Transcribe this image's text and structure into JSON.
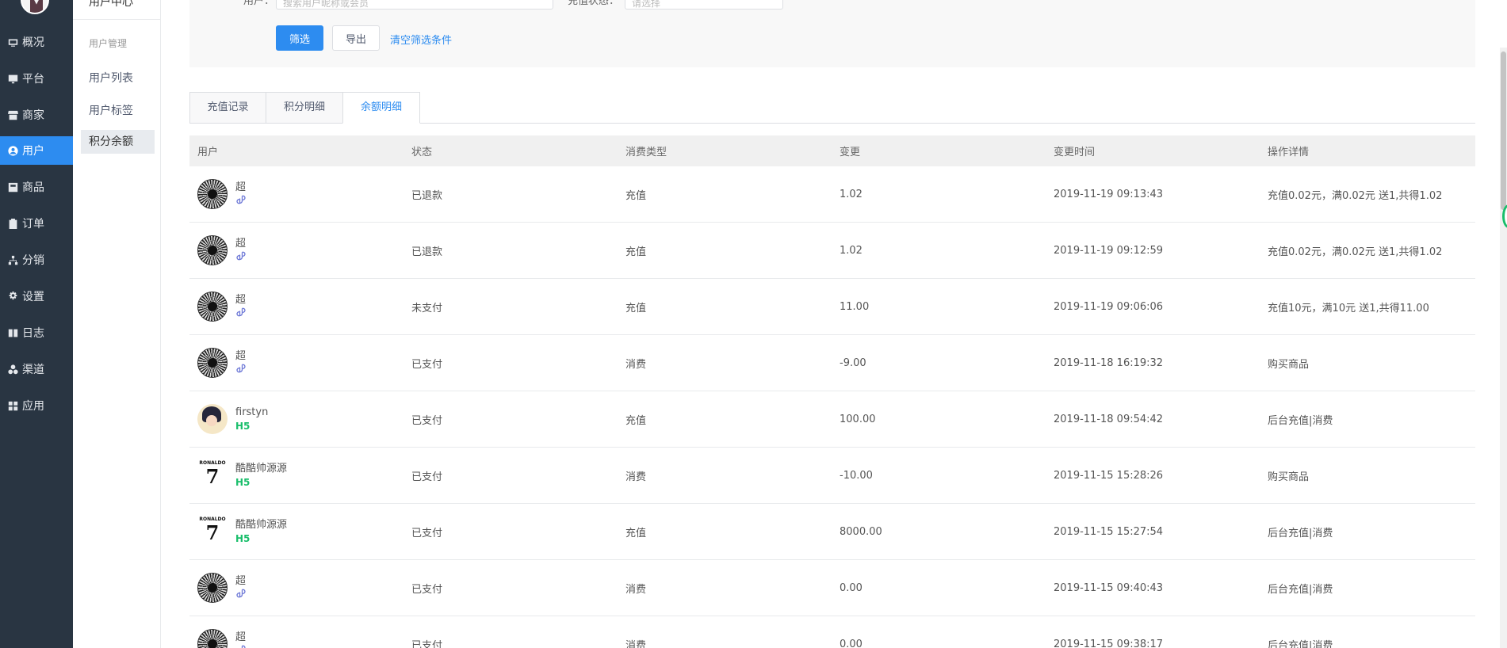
{
  "sidebar": {
    "items": [
      {
        "label": "概况",
        "icon": "dashboard-icon"
      },
      {
        "label": "平台",
        "icon": "monitor-icon"
      },
      {
        "label": "商家",
        "icon": "store-icon"
      },
      {
        "label": "用户",
        "icon": "user-icon",
        "active": true
      },
      {
        "label": "商品",
        "icon": "product-icon"
      },
      {
        "label": "订单",
        "icon": "clipboard-icon"
      },
      {
        "label": "分销",
        "icon": "hierarchy-icon"
      },
      {
        "label": "设置",
        "icon": "gear-icon"
      },
      {
        "label": "日志",
        "icon": "book-icon"
      },
      {
        "label": "渠道",
        "icon": "channels-icon"
      },
      {
        "label": "应用",
        "icon": "grid-icon"
      }
    ]
  },
  "subsidebar": {
    "title": "用户中心",
    "group": "用户管理",
    "items": [
      {
        "label": "用户列表"
      },
      {
        "label": "用户标签"
      },
      {
        "label": "积分余额",
        "active": true
      }
    ]
  },
  "filter": {
    "user_label": "用户：",
    "user_placeholder": "搜索用户昵称或会员",
    "status_label": "充值状态：",
    "status_placeholder": "请选择",
    "filter_button": "筛选",
    "export_button": "导出",
    "clear_link": "清空筛选条件"
  },
  "tabs": [
    {
      "label": "充值记录"
    },
    {
      "label": "积分明细"
    },
    {
      "label": "余额明细",
      "active": true
    }
  ],
  "table": {
    "headers": [
      "用户",
      "状态",
      "消费类型",
      "变更",
      "变更时间",
      "操作详情"
    ],
    "rows": [
      {
        "name": "超",
        "platform": "miniapp",
        "status": "已退款",
        "type": "充值",
        "change": "1.02",
        "time": "2019-11-19 09:13:43",
        "detail": "充值0.02元，满0.02元 送1,共得1.02"
      },
      {
        "name": "超",
        "platform": "miniapp",
        "status": "已退款",
        "type": "充值",
        "change": "1.02",
        "time": "2019-11-19 09:12:59",
        "detail": "充值0.02元，满0.02元 送1,共得1.02"
      },
      {
        "name": "超",
        "platform": "miniapp",
        "status": "未支付",
        "type": "充值",
        "change": "11.00",
        "time": "2019-11-19 09:06:06",
        "detail": "充值10元，满10元 送1,共得11.00"
      },
      {
        "name": "超",
        "platform": "miniapp",
        "status": "已支付",
        "type": "消费",
        "change": "-9.00",
        "time": "2019-11-18 16:19:32",
        "detail": "购买商品"
      },
      {
        "name": "firstyn",
        "platform": "H5",
        "status": "已支付",
        "type": "充值",
        "change": "100.00",
        "time": "2019-11-18 09:54:42",
        "detail": "后台充值|消费"
      },
      {
        "name": "酷酷帅源源",
        "platform": "H5",
        "status": "已支付",
        "type": "消费",
        "change": "-10.00",
        "time": "2019-11-15 15:28:26",
        "detail": "购买商品"
      },
      {
        "name": "酷酷帅源源",
        "platform": "H5",
        "status": "已支付",
        "type": "充值",
        "change": "8000.00",
        "time": "2019-11-15 15:27:54",
        "detail": "后台充值|消费"
      },
      {
        "name": "超",
        "platform": "miniapp",
        "status": "已支付",
        "type": "消费",
        "change": "0.00",
        "time": "2019-11-15 09:40:43",
        "detail": "后台充值|消费"
      },
      {
        "name": "超",
        "platform": "miniapp",
        "status": "已支付",
        "type": "消费",
        "change": "0.00",
        "time": "2019-11-15 09:38:17",
        "detail": "后台充值|消费"
      }
    ]
  },
  "avatar_text": {
    "jersey_top": "RONALDO",
    "jersey_number": "7"
  },
  "colors": {
    "primary": "#2d8cf0",
    "sidebar": "#293542",
    "h5": "#19be6b"
  }
}
